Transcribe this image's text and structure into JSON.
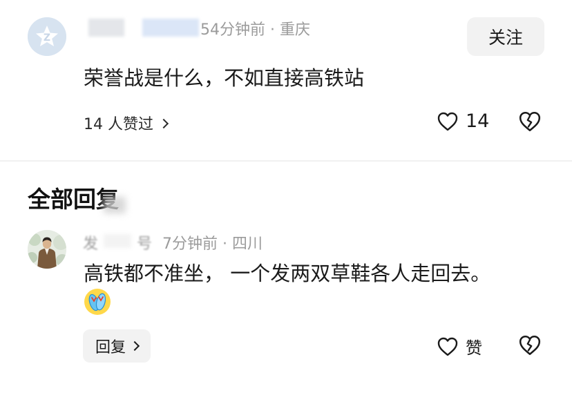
{
  "main_comment": {
    "time": "54分钟前",
    "separator": "·",
    "location": "重庆",
    "follow_label": "关注",
    "text": "荣誉战是什么，不如直接高铁站",
    "likes_summary": "14 人赞过",
    "like_count": "14"
  },
  "replies_section": {
    "title": "全部回复"
  },
  "reply": {
    "author_partial": "发",
    "author_suffix": "号",
    "time": "7分钟前",
    "separator": "·",
    "location": "四川",
    "text": "高铁都不准坐，  一个发两双草鞋各人走回去。",
    "emoji": "🩴",
    "reply_label": "回复",
    "like_label": "赞"
  },
  "colors": {
    "text": "#1a1a1a",
    "meta": "#9b9b9b",
    "button_bg": "#f2f2f2",
    "divider": "#f0f0f0"
  },
  "icons": {
    "heart": "heart-icon",
    "broken_heart": "broken-heart-icon",
    "chevron": "chevron-right-icon"
  }
}
